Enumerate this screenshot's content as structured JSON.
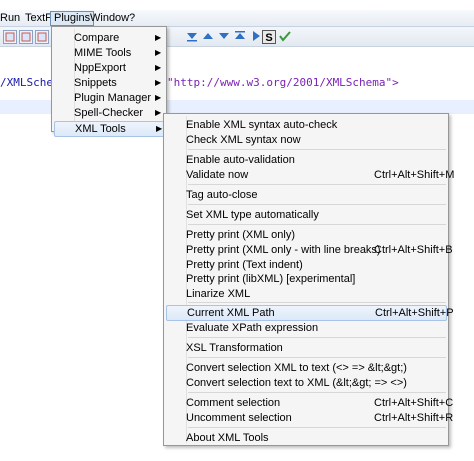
{
  "menubar": {
    "items": [
      "Run",
      "TextFX",
      "Plugins",
      "Window",
      "?"
    ]
  },
  "toolbar": {
    "s_label": "S"
  },
  "editor": {
    "line_left": "/XMLSchema",
    "line_right": "\"http://www.w3.org/2001/XMLSchema\">"
  },
  "plugins_menu": {
    "items": [
      {
        "label": "Compare",
        "submenu": true
      },
      {
        "label": "MIME Tools",
        "submenu": true
      },
      {
        "label": "NppExport",
        "submenu": true
      },
      {
        "label": "Snippets",
        "submenu": true
      },
      {
        "label": "Plugin Manager",
        "submenu": true
      },
      {
        "label": "Spell-Checker",
        "submenu": true
      },
      {
        "label": "XML Tools",
        "submenu": true,
        "highlighted": true
      }
    ]
  },
  "xml_tools_menu": {
    "items": [
      {
        "label": "Enable XML syntax auto-check",
        "shortcut": ""
      },
      {
        "label": "Check XML syntax now",
        "shortcut": ""
      },
      {
        "label": "Enable auto-validation",
        "shortcut": ""
      },
      {
        "label": "Validate now",
        "shortcut": "Ctrl+Alt+Shift+M"
      },
      {
        "label": "Tag auto-close",
        "shortcut": ""
      },
      {
        "label": "Set XML type automatically",
        "shortcut": ""
      },
      {
        "label": "Pretty print (XML only)",
        "shortcut": ""
      },
      {
        "label": "Pretty print (XML only - with line breaks)",
        "shortcut": "Ctrl+Alt+Shift+B"
      },
      {
        "label": "Pretty print (Text indent)",
        "shortcut": ""
      },
      {
        "label": "Pretty print (libXML) [experimental]",
        "shortcut": ""
      },
      {
        "label": "Linarize XML",
        "shortcut": ""
      },
      {
        "label": "Current XML Path",
        "shortcut": "Ctrl+Alt+Shift+P",
        "highlighted": true
      },
      {
        "label": "Evaluate XPath expression",
        "shortcut": ""
      },
      {
        "label": "XSL Transformation",
        "shortcut": ""
      },
      {
        "label": "Convert selection XML to text (<> => &lt;&gt;)",
        "shortcut": ""
      },
      {
        "label": "Convert selection text to XML (&lt;&gt; => <>)",
        "shortcut": ""
      },
      {
        "label": "Comment selection",
        "shortcut": "Ctrl+Alt+Shift+C"
      },
      {
        "label": "Uncomment selection",
        "shortcut": "Ctrl+Alt+Shift+R"
      },
      {
        "label": "About XML Tools",
        "shortcut": ""
      }
    ]
  }
}
